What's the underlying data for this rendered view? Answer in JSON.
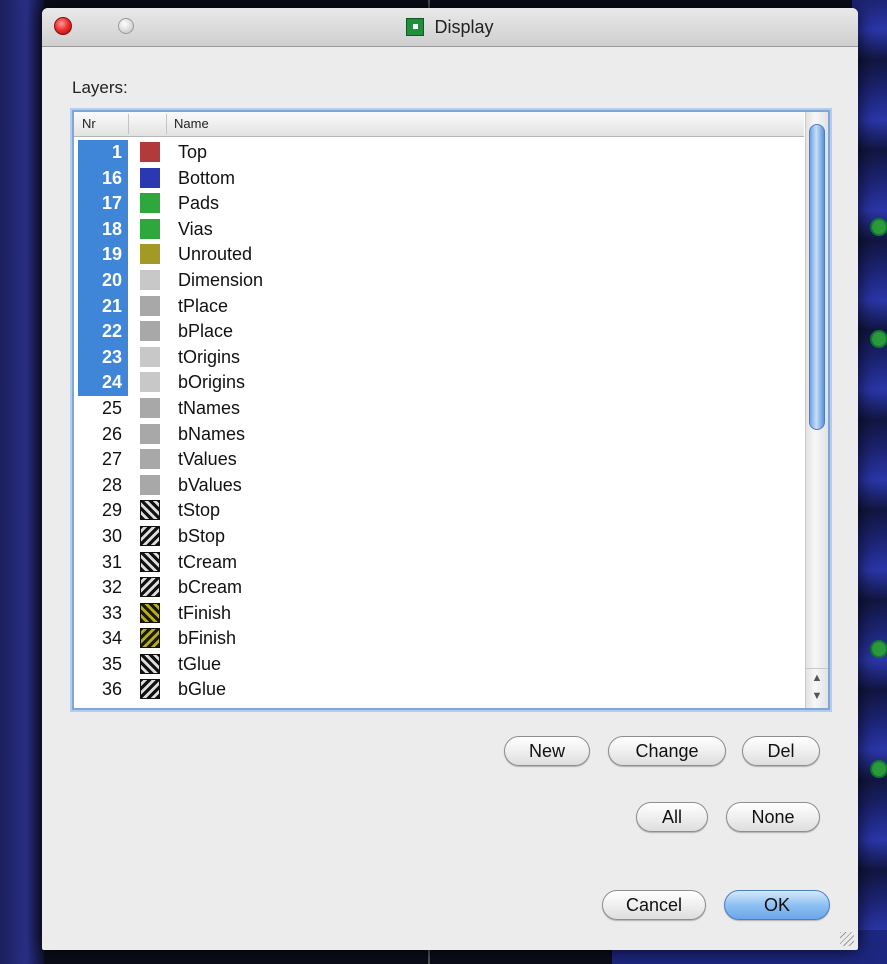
{
  "window": {
    "title": "Display",
    "icon": "eagle-app-icon"
  },
  "layers_label": "Layers:",
  "list": {
    "columns": [
      "Nr",
      "",
      "Name"
    ],
    "rows": [
      {
        "nr": "1",
        "name": "Top",
        "color": "#b23a3a",
        "selected": true
      },
      {
        "nr": "16",
        "name": "Bottom",
        "color": "#2a39b0",
        "selected": true
      },
      {
        "nr": "17",
        "name": "Pads",
        "color": "#2ea83c",
        "selected": true
      },
      {
        "nr": "18",
        "name": "Vias",
        "color": "#2ea83c",
        "selected": true
      },
      {
        "nr": "19",
        "name": "Unrouted",
        "color": "#a39a25",
        "selected": true
      },
      {
        "nr": "20",
        "name": "Dimension",
        "color": "#c8c8c8",
        "selected": true
      },
      {
        "nr": "21",
        "name": "tPlace",
        "color": "#a8a8a8",
        "selected": true
      },
      {
        "nr": "22",
        "name": "bPlace",
        "color": "#a8a8a8",
        "selected": true
      },
      {
        "nr": "23",
        "name": "tOrigins",
        "color": "#c8c8c8",
        "selected": true
      },
      {
        "nr": "24",
        "name": "bOrigins",
        "color": "#c8c8c8",
        "selected": true
      },
      {
        "nr": "25",
        "name": "tNames",
        "color": "#a8a8a8",
        "selected": false
      },
      {
        "nr": "26",
        "name": "bNames",
        "color": "#a8a8a8",
        "selected": false
      },
      {
        "nr": "27",
        "name": "tValues",
        "color": "#a8a8a8",
        "selected": false
      },
      {
        "nr": "28",
        "name": "bValues",
        "color": "#a8a8a8",
        "selected": false
      },
      {
        "nr": "29",
        "name": "tStop",
        "pattern": "hatch-a",
        "selected": false
      },
      {
        "nr": "30",
        "name": "bStop",
        "pattern": "hatch-b",
        "selected": false
      },
      {
        "nr": "31",
        "name": "tCream",
        "pattern": "hatch-a",
        "selected": false
      },
      {
        "nr": "32",
        "name": "bCream",
        "pattern": "hatch-b",
        "selected": false
      },
      {
        "nr": "33",
        "name": "tFinish",
        "pattern": "hatch-ya",
        "selected": false
      },
      {
        "nr": "34",
        "name": "bFinish",
        "pattern": "hatch-yb",
        "selected": false
      },
      {
        "nr": "35",
        "name": "tGlue",
        "pattern": "hatch-a",
        "selected": false
      },
      {
        "nr": "36",
        "name": "bGlue",
        "pattern": "hatch-b",
        "selected": false
      }
    ]
  },
  "buttons": {
    "new": "New",
    "change": "Change",
    "del": "Del",
    "all": "All",
    "none": "None",
    "cancel": "Cancel",
    "ok": "OK"
  }
}
